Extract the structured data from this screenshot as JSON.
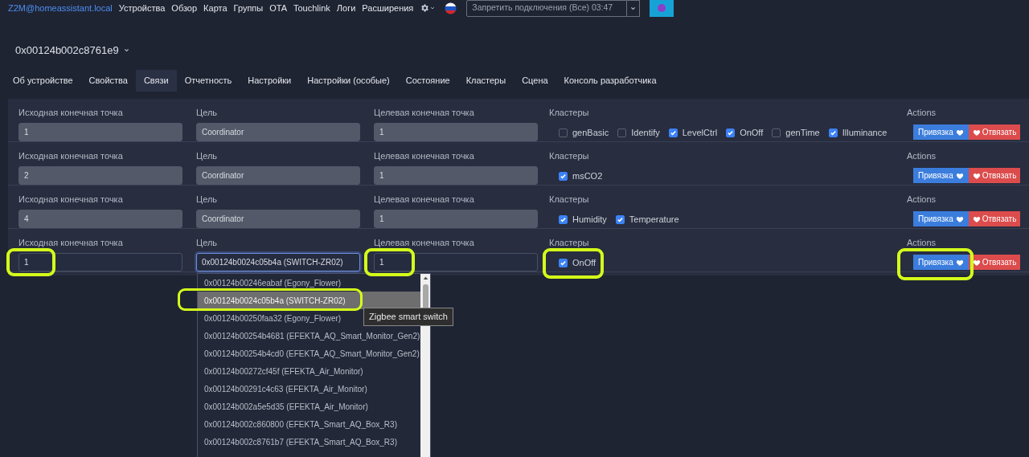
{
  "nav": {
    "brand": "Z2M@homeassistant.local",
    "links": [
      "Устройства",
      "Обзор",
      "Карта",
      "Группы",
      "OTA",
      "Touchlink",
      "Логи",
      "Расширения"
    ],
    "permit_join": "Запретить подключения (Все) 03:47"
  },
  "device": {
    "title": "0x00124b002c8761e9"
  },
  "tabs": [
    {
      "label": "Об устройстве",
      "selected": false
    },
    {
      "label": "Свойства",
      "selected": false
    },
    {
      "label": "Связи",
      "selected": true
    },
    {
      "label": "Отчетность",
      "selected": false
    },
    {
      "label": "Настройки",
      "selected": false
    },
    {
      "label": "Настройки (особые)",
      "selected": false
    },
    {
      "label": "Состояние",
      "selected": false
    },
    {
      "label": "Кластеры",
      "selected": false
    },
    {
      "label": "Сцена",
      "selected": false
    },
    {
      "label": "Консоль разработчика",
      "selected": false
    }
  ],
  "bindings": [
    {
      "source_label": "Исходная конечная точка",
      "source": "1",
      "target_label": "Цель",
      "target": "Coordinator",
      "target_focused": false,
      "dest_label": "Целевая конечная точка",
      "dest": "1",
      "disabled": true,
      "clusters_label": "Кластеры",
      "clusters": [
        {
          "name": "genBasic",
          "checked": false
        },
        {
          "name": "Identify",
          "checked": false
        },
        {
          "name": "LevelCtrl",
          "checked": true
        },
        {
          "name": "OnOff",
          "checked": true
        },
        {
          "name": "genTime",
          "checked": false
        },
        {
          "name": "Illuminance",
          "checked": true
        }
      ],
      "actions_label": "Actions",
      "bind": "Привязка",
      "unbind": "Отвязать"
    },
    {
      "source_label": "Исходная конечная точка",
      "source": "2",
      "target_label": "Цель",
      "target": "Coordinator",
      "target_focused": false,
      "dest_label": "Целевая конечная точка",
      "dest": "1",
      "disabled": true,
      "clusters_label": "Кластеры",
      "clusters": [
        {
          "name": "msCO2",
          "checked": true
        }
      ],
      "actions_label": "Actions",
      "bind": "Привязка",
      "unbind": "Отвязать"
    },
    {
      "source_label": "Исходная конечная точка",
      "source": "4",
      "target_label": "Цель",
      "target": "Coordinator",
      "target_focused": false,
      "dest_label": "Целевая конечная точка",
      "dest": "1",
      "disabled": true,
      "clusters_label": "Кластеры",
      "clusters": [
        {
          "name": "Humidity",
          "checked": true
        },
        {
          "name": "Temperature",
          "checked": true
        }
      ],
      "actions_label": "Actions",
      "bind": "Привязка",
      "unbind": "Отвязать"
    },
    {
      "source_label": "Исходная конечная точка",
      "source": "1",
      "target_label": "Цель",
      "target": "0x00124b0024c05b4a (SWITCH-ZR02)",
      "target_focused": true,
      "dest_label": "Целевая конечная точка",
      "dest": "1",
      "disabled": false,
      "clusters_label": "Кластеры",
      "clusters": [
        {
          "name": "OnOff",
          "checked": true
        }
      ],
      "actions_label": "Actions",
      "bind": "Привязка",
      "unbind": "Отвязать"
    }
  ],
  "dropdown": {
    "items": [
      {
        "label": "0x00124b00246eabaf (Egony_Flower)",
        "selected": false
      },
      {
        "label": "0x00124b0024c05b4a (SWITCH-ZR02)",
        "selected": true
      },
      {
        "label": "0x00124b00250faa32 (Egony_Flower)",
        "selected": false
      },
      {
        "label": "0x00124b00254b4681 (EFEKTA_AQ_Smart_Monitor_Gen2)",
        "selected": false
      },
      {
        "label": "0x00124b00254b4cd0 (EFEKTA_AQ_Smart_Monitor_Gen2)",
        "selected": false
      },
      {
        "label": "0x00124b00272cf45f (EFEKTA_Air_Monitor)",
        "selected": false
      },
      {
        "label": "0x00124b00291c4c63 (EFEKTA_Air_Monitor)",
        "selected": false
      },
      {
        "label": "0x00124b002a5e5d35 (EFEKTA_Air_Monitor)",
        "selected": false
      },
      {
        "label": "0x00124b002c860800 (EFEKTA_Smart_AQ_Box_R3)",
        "selected": false
      },
      {
        "label": "0x00124b002c8761b7 (EFEKTA_Smart_AQ_Box_R3)",
        "selected": false
      }
    ],
    "tooltip": "Zigbee smart switch"
  }
}
